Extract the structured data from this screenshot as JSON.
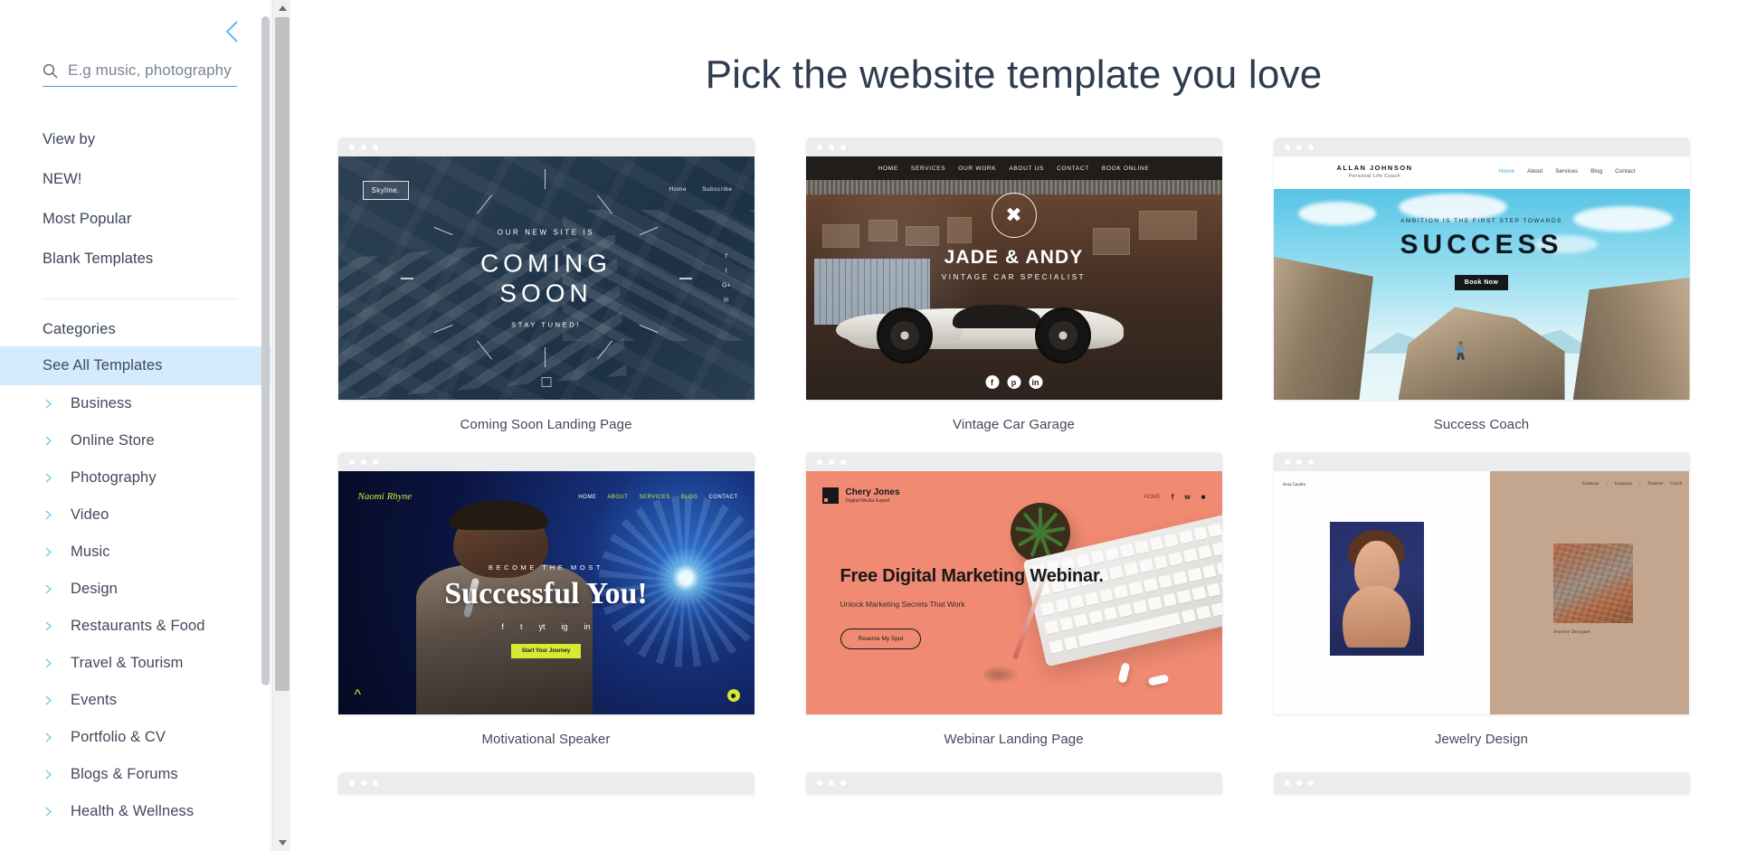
{
  "sidebar": {
    "collapse_icon": "chevron-left-icon",
    "search": {
      "icon": "search-icon",
      "placeholder": "E.g music, photography",
      "value": ""
    },
    "view_by_label": "View by",
    "view_by_items": [
      "NEW!",
      "Most Popular",
      "Blank Templates"
    ],
    "categories_label": "Categories",
    "see_all_label": "See All Templates",
    "categories": [
      "Business",
      "Online Store",
      "Photography",
      "Video",
      "Music",
      "Design",
      "Restaurants & Food",
      "Travel & Tourism",
      "Events",
      "Portfolio & CV",
      "Blogs & Forums",
      "Health & Wellness"
    ],
    "accent_color": "#3899ec",
    "highlight_color": "#d3ebfb"
  },
  "main": {
    "title": "Pick the website template you love",
    "templates": [
      {
        "caption": "Coming Soon Landing Page",
        "logo": "Skyline.",
        "nav": [
          "Home",
          "Subscribe"
        ],
        "kicker": "OUR NEW SITE IS",
        "headline_1": "COMING",
        "headline_2": "SOON",
        "footer_text": "STAY TUNED!",
        "socials": [
          "f",
          "t",
          "G+",
          "in"
        ]
      },
      {
        "caption": "Vintage Car Garage",
        "nav": [
          "HOME",
          "SERVICES",
          "OUR WORK",
          "ABOUT US",
          "CONTACT",
          "BOOK ONLINE"
        ],
        "emblem": "wrench-cross-icon",
        "title": "JADE & ANDY",
        "subtitle": "VINTAGE CAR SPECIALIST",
        "socials": [
          "f",
          "p",
          "in"
        ]
      },
      {
        "caption": "Success Coach",
        "brand": "ALLAN JOHNSON",
        "brand_sub": "Personal Life Coach",
        "nav": [
          "Home",
          "About",
          "Services",
          "Blog",
          "Contact"
        ],
        "kicker": "AMBITION IS THE FIRST STEP TOWARDS",
        "headline": "SUCCESS",
        "button": "Book Now"
      },
      {
        "caption": "Motivational Speaker",
        "brand": "Naomi Rhyne",
        "nav": [
          "HOME",
          "ABOUT",
          "SERVICES",
          "BLOG",
          "CONTACT"
        ],
        "kicker": "BECOME THE MOST",
        "headline": "Successful You!",
        "socials": [
          "f",
          "t",
          "yt",
          "ig",
          "in"
        ],
        "button": "Start Your Journey",
        "accent": "#d6e933"
      },
      {
        "caption": "Webinar Landing Page",
        "brand": "Chery Jones",
        "brand_sub": "Digital Media Expert",
        "nav": [
          "HOME"
        ],
        "headline": "Free Digital Marketing Webinar.",
        "subtitle": "Unlock Marketing Secrets That Work",
        "button": "Reserve My Spot",
        "accent": "#f08a72"
      },
      {
        "caption": "Jewelry Design",
        "brand_small": "Ania Gaudin",
        "name_vertical": "Ania Gaudin",
        "nav": [
          "Facebook",
          "/",
          "Instagram",
          "/",
          "Pinterest",
          "Care/It"
        ],
        "image_caption": "Jewelry Designer"
      }
    ]
  }
}
